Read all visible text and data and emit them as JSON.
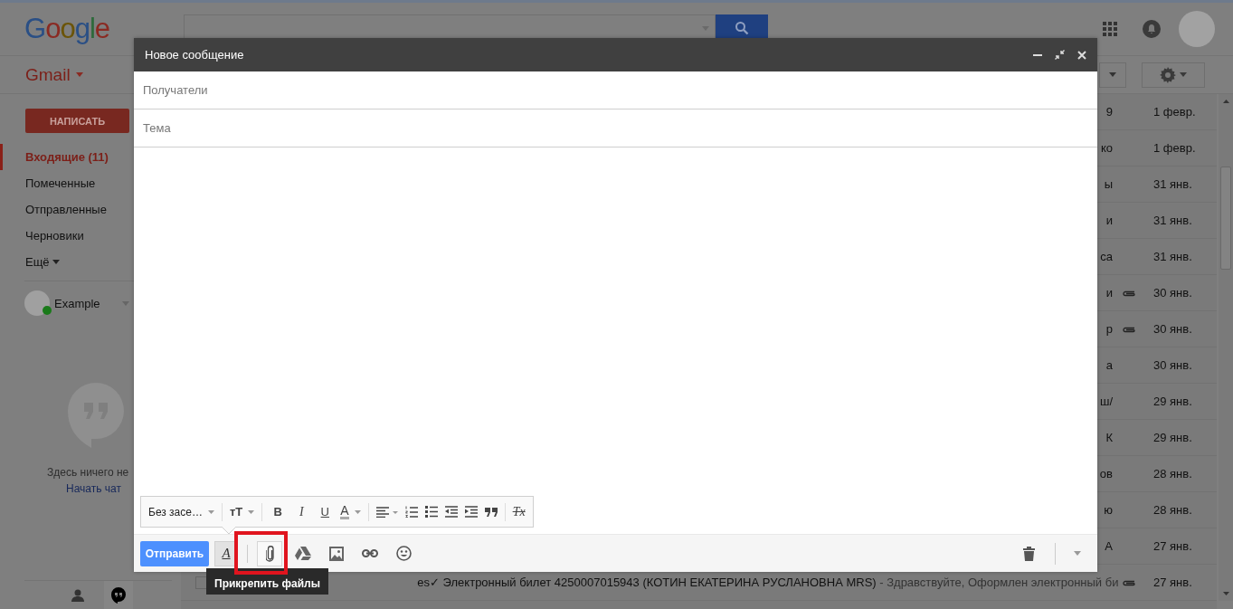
{
  "header": {
    "logo": "Google"
  },
  "app_menu": {
    "label": "Gmail"
  },
  "compose_button": "НАПИСАТЬ",
  "folders": [
    {
      "label": "Входящие (11)",
      "selected": true
    },
    {
      "label": "Помеченные",
      "selected": false
    },
    {
      "label": "Отправленные",
      "selected": false
    },
    {
      "label": "Черновики",
      "selected": false
    }
  ],
  "more_link": "Ещё",
  "chat": {
    "user": "Example",
    "online": true,
    "empty_text": "Здесь ничего не",
    "start_link": "Начать чат"
  },
  "emails": [
    {
      "subject": "9",
      "attachment": false,
      "date": "1 февр."
    },
    {
      "subject": "ко",
      "attachment": false,
      "date": "1 февр."
    },
    {
      "subject": "ы",
      "attachment": false,
      "date": "31 янв."
    },
    {
      "subject": "и",
      "attachment": false,
      "date": "31 янв."
    },
    {
      "subject": "са",
      "attachment": false,
      "date": "31 янв."
    },
    {
      "subject": "и",
      "attachment": true,
      "date": "30 янв."
    },
    {
      "subject": "р",
      "attachment": true,
      "date": "30 янв."
    },
    {
      "subject": "а",
      "attachment": false,
      "date": "30 янв."
    },
    {
      "subject": "ш/",
      "attachment": false,
      "date": "29 янв."
    },
    {
      "subject": "К",
      "attachment": false,
      "date": "29 янв."
    },
    {
      "subject": "ов",
      "attachment": false,
      "date": "28 янв."
    },
    {
      "subject": "ю",
      "attachment": false,
      "date": "28 янв."
    },
    {
      "subject": "А",
      "attachment": false,
      "date": "27 янв."
    },
    {
      "checked": false,
      "sender": "es",
      "subject": "✓ Электронный билет 4250007015943 (КОТИН ЕКАТЕРИНА РУСЛАНОВНА MRS)",
      "snippet": " - Здравствуйте, Оформлен электронный би",
      "attachment": true,
      "date": "27 янв."
    }
  ],
  "compose": {
    "title": "Новое сообщение",
    "recipients": {
      "placeholder": "Получатели"
    },
    "subject": {
      "placeholder": "Тема"
    },
    "format_toolbar": [
      {
        "kind": "dropdown",
        "label": "Без засе…"
      },
      {
        "kind": "divider"
      },
      {
        "kind": "size",
        "label": "тT"
      },
      {
        "kind": "divider"
      },
      {
        "kind": "bold",
        "label": "B"
      },
      {
        "kind": "italic",
        "label": "I"
      },
      {
        "kind": "underline",
        "label": "U"
      },
      {
        "kind": "color",
        "label": "A"
      },
      {
        "kind": "divider"
      },
      {
        "kind": "align"
      },
      {
        "kind": "numbered"
      },
      {
        "kind": "bulleted"
      },
      {
        "kind": "outdent"
      },
      {
        "kind": "indent"
      },
      {
        "kind": "quote"
      },
      {
        "kind": "divider"
      },
      {
        "kind": "clear",
        "label": "Tx"
      }
    ],
    "send": "Отправить",
    "format_toggle": {
      "label": "A",
      "selected": true
    },
    "actions": [
      {
        "kind": "attach",
        "hovered": true
      },
      {
        "kind": "drive",
        "hovered": false
      },
      {
        "kind": "photo",
        "hovered": false
      },
      {
        "kind": "link",
        "hovered": false
      },
      {
        "kind": "emoji",
        "hovered": false
      }
    ],
    "tooltip": "Прикрепить файлы"
  },
  "highlight": {
    "on": true
  }
}
